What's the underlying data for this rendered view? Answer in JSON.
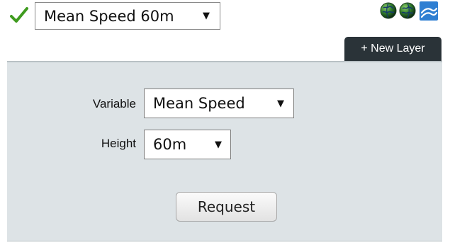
{
  "layer": {
    "status_icon": "check-icon",
    "selected": "Mean Speed 60m",
    "arrow": "▼"
  },
  "toolbar": {
    "icons": [
      "globe-icon",
      "globe-icon",
      "chart-icon"
    ],
    "new_layer_label": "+ New Layer"
  },
  "form": {
    "variable_label": "Variable",
    "variable_value": "Mean Speed",
    "height_label": "Height",
    "height_value": "60m",
    "arrow": "▼",
    "request_label": "Request"
  },
  "colors": {
    "check": "#3f9b1f",
    "panel_bg": "#dde3e6",
    "new_layer_bg": "#2a3338",
    "chart_icon_bg": "#2f7fd2"
  }
}
